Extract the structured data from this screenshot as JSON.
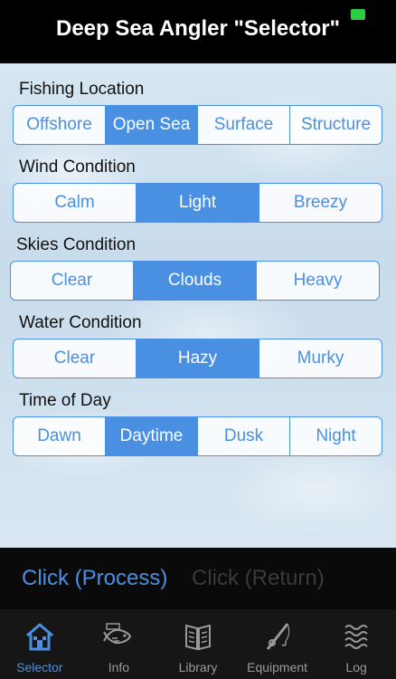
{
  "header": {
    "title": "Deep Sea Angler \"Selector\""
  },
  "colors": {
    "accent": "#4a90e2",
    "header_bg": "#000000",
    "battery": "#2ecc40"
  },
  "sections": {
    "fishing_location": {
      "label": "Fishing Location",
      "options": [
        "Offshore",
        "Open Sea",
        "Surface",
        "Structure"
      ],
      "selected": "Open Sea"
    },
    "wind_condition": {
      "label": "Wind Condition",
      "options": [
        "Calm",
        "Light",
        "Breezy"
      ],
      "selected": "Light"
    },
    "skies_condition": {
      "label": "Skies Condition",
      "options": [
        "Clear",
        "Clouds",
        "Heavy"
      ],
      "selected": "Clouds"
    },
    "water_condition": {
      "label": "Water Condition",
      "options": [
        "Clear",
        "Hazy",
        "Murky"
      ],
      "selected": "Hazy"
    },
    "time_of_day": {
      "label": "Time of Day",
      "options": [
        "Dawn",
        "Daytime",
        "Dusk",
        "Night"
      ],
      "selected": "Daytime"
    }
  },
  "actions": {
    "process": "Click (Process)",
    "return": "Click (Return)"
  },
  "tabs": [
    {
      "label": "Selector",
      "icon": "house-icon",
      "active": true
    },
    {
      "label": "Info",
      "icon": "fish-icon",
      "active": false
    },
    {
      "label": "Library",
      "icon": "book-icon",
      "active": false
    },
    {
      "label": "Equipment",
      "icon": "fishing-rod-icon",
      "active": false
    },
    {
      "label": "Log",
      "icon": "waves-icon",
      "active": false
    }
  ]
}
